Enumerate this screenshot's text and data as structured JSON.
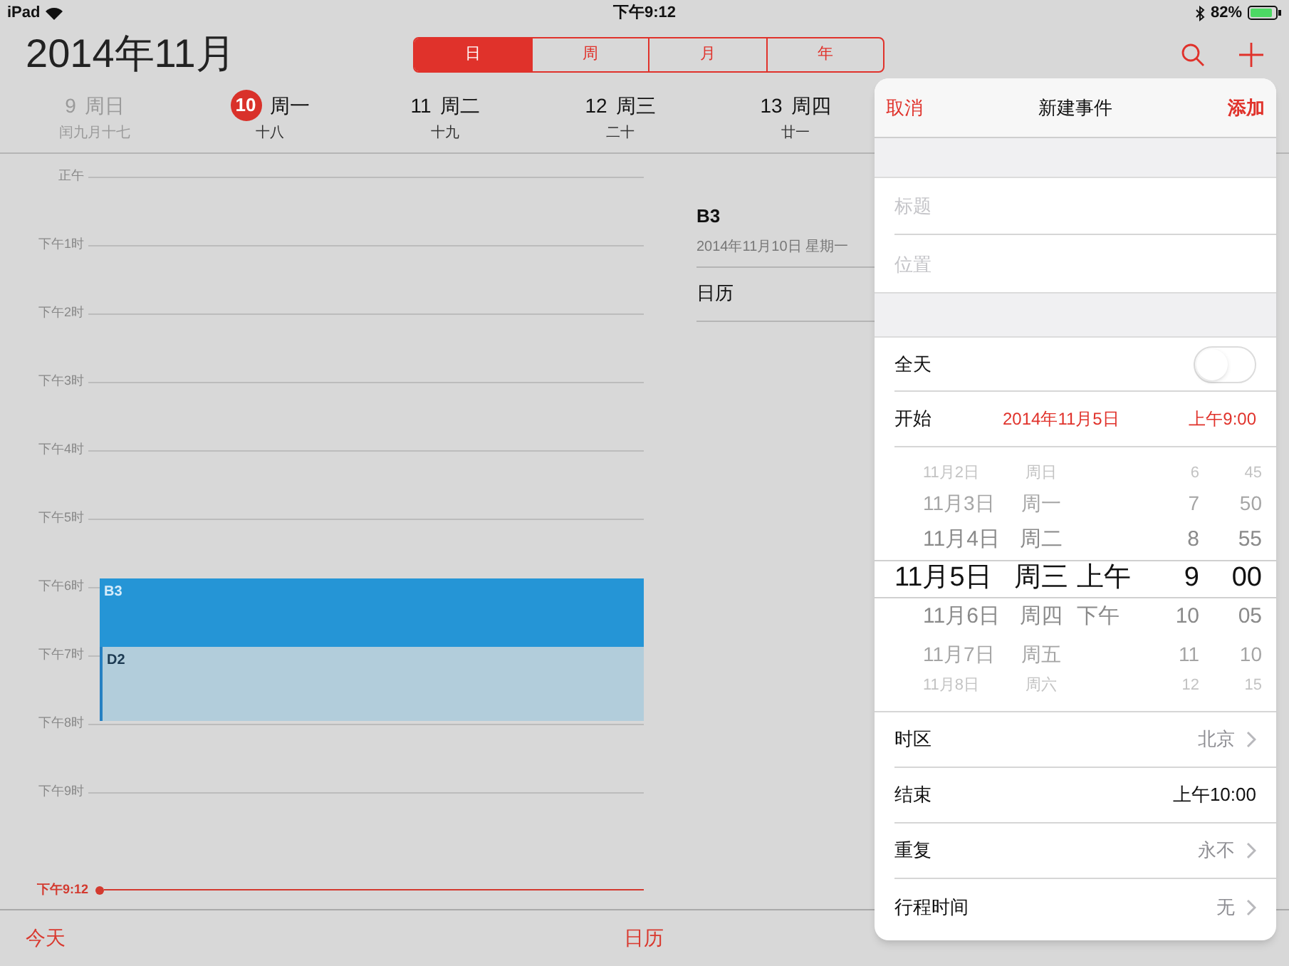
{
  "status_bar": {
    "device": "iPad",
    "time": "下午9:12",
    "battery": "82%"
  },
  "header": {
    "title": "2014年11月",
    "view_tabs": [
      {
        "label": "日",
        "selected": true
      },
      {
        "label": "周",
        "selected": false
      },
      {
        "label": "月",
        "selected": false
      },
      {
        "label": "年",
        "selected": false
      }
    ]
  },
  "week_days": [
    {
      "date": "9",
      "weekday": "周日",
      "lunar": "闰九月十七",
      "selected": false,
      "dimmed": true
    },
    {
      "date": "10",
      "weekday": "周一",
      "lunar": "十八",
      "selected": true,
      "dimmed": false
    },
    {
      "date": "11",
      "weekday": "周二",
      "lunar": "十九",
      "selected": false,
      "dimmed": false
    },
    {
      "date": "12",
      "weekday": "周三",
      "lunar": "二十",
      "selected": false,
      "dimmed": false
    },
    {
      "date": "13",
      "weekday": "周四",
      "lunar": "廿一",
      "selected": false,
      "dimmed": false
    }
  ],
  "timeline": {
    "hours": [
      {
        "label": "正午"
      },
      {
        "label": "下午1时"
      },
      {
        "label": "下午2时"
      },
      {
        "label": "下午3时"
      },
      {
        "label": "下午4时"
      },
      {
        "label": "下午5时"
      },
      {
        "label": "下午6时",
        "events": [
          {
            "title": "B3",
            "selected": true
          }
        ]
      },
      {
        "label": "下午7时",
        "events": [
          {
            "title": "D2",
            "selected": false
          }
        ]
      },
      {
        "label": "下午8时"
      },
      {
        "label": "下午9时"
      }
    ],
    "now_label": "下午9:12"
  },
  "detail": {
    "title": "B3",
    "date": "2014年11月10日 星期一",
    "calendar": "日历"
  },
  "toolbar": {
    "today": "今天",
    "calendars": "日历"
  },
  "new_event": {
    "cancel": "取消",
    "title": "新建事件",
    "add": "添加",
    "fields": [
      {
        "placeholder": "标题"
      },
      {
        "placeholder": "位置"
      }
    ],
    "all_day": {
      "label": "全天",
      "on": false
    },
    "start": {
      "label": "开始",
      "date": "2014年11月5日",
      "time": "上午9:00"
    },
    "picker": [
      {
        "date": "11月2日",
        "weekday": "周日",
        "hour": "6",
        "minute": "45",
        "selected": false
      },
      {
        "date": "11月3日",
        "weekday": "周一",
        "hour": "7",
        "minute": "50",
        "selected": false
      },
      {
        "date": "11月4日",
        "weekday": "周二",
        "hour": "8",
        "minute": "55",
        "selected": false
      },
      {
        "date": "11月5日",
        "weekday": "周三",
        "ampm": "上午",
        "hour": "9",
        "minute": "00",
        "selected": true
      },
      {
        "date": "11月6日",
        "weekday": "周四",
        "ampm": "下午",
        "hour": "10",
        "minute": "05",
        "selected": false
      },
      {
        "date": "11月7日",
        "weekday": "周五",
        "hour": "11",
        "minute": "10",
        "selected": false
      },
      {
        "date": "11月8日",
        "weekday": "周六",
        "hour": "12",
        "minute": "15",
        "selected": false
      }
    ],
    "rows": [
      {
        "label": "时区",
        "value": "北京",
        "chevron": true
      },
      {
        "label": "结束",
        "value": "上午10:00",
        "chevron": false
      },
      {
        "label": "重复",
        "value": "永不",
        "chevron": true
      },
      {
        "label": "行程时间",
        "value": "无",
        "chevron": true
      }
    ]
  }
}
